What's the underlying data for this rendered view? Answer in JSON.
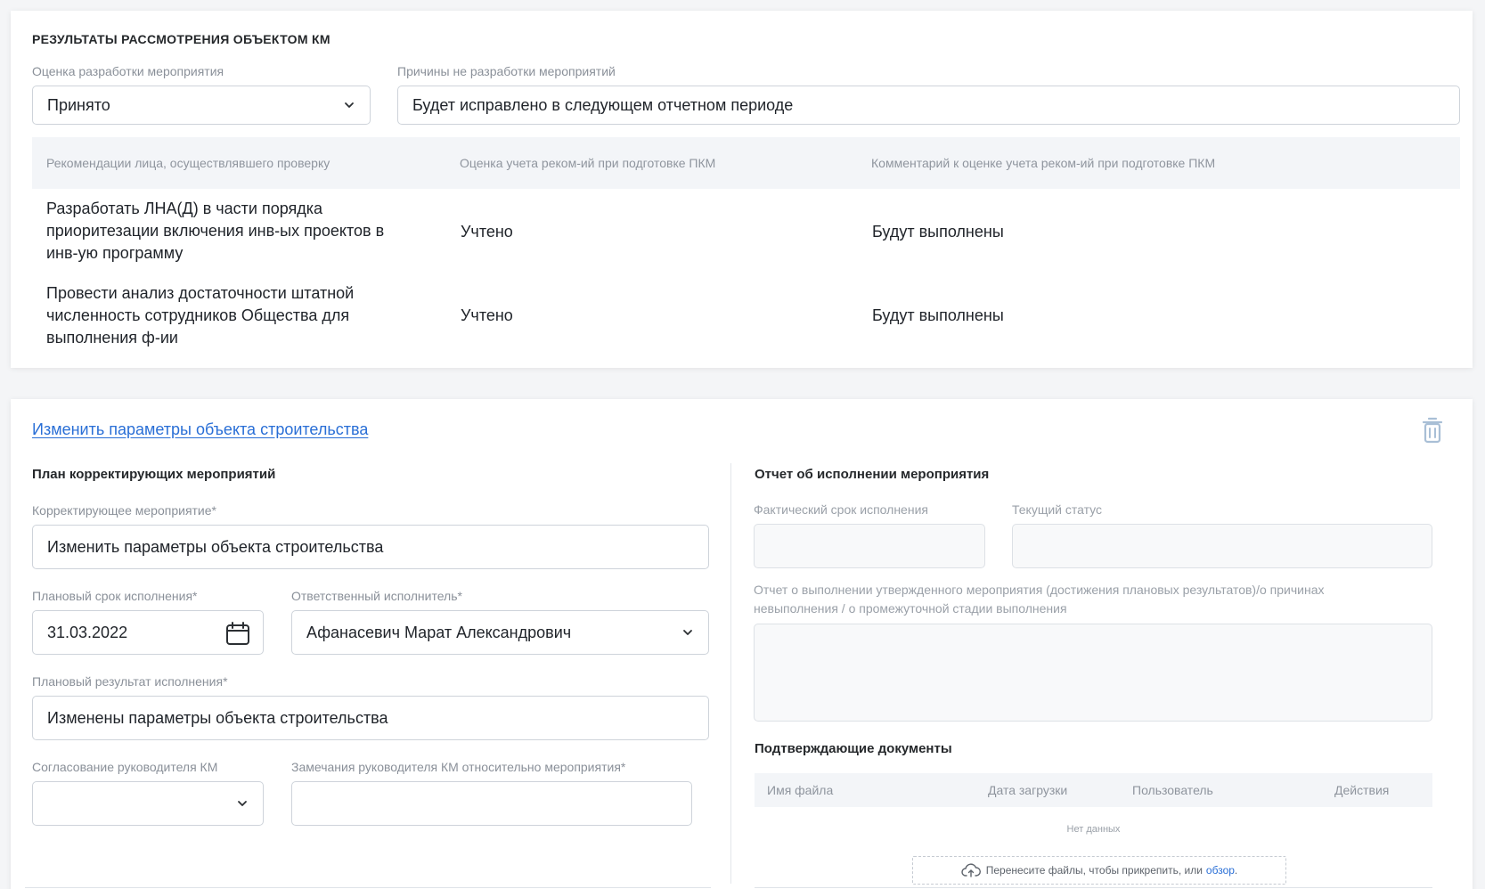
{
  "review": {
    "title": "РЕЗУЛЬТАТЫ РАССМОТРЕНИЯ ОБЪЕКТОМ КМ",
    "assessment_label": "Оценка разработки мероприятия",
    "assessment_value": "Принято",
    "reasons_label": "Причины не разработки мероприятий",
    "reasons_value": "Будет исправлено в следующем отчетном периоде",
    "table": {
      "headers": [
        "Рекомендации лица, осуществлявшего проверку",
        "Оценка учета реком-ий при подготовке ПКМ",
        "Комментарий к оценке учета реком-ий при подготовке ПКМ"
      ],
      "rows": [
        {
          "recommendation": "Разработать ЛНА(Д) в части порядка приоритезации включения инв-ых проектов в инв-ую программу",
          "assessment": "Учтено",
          "comment": "Будут выполнены"
        },
        {
          "recommendation": "Провести анализ достаточности штатной численность сотрудников Общества для выполнения ф-ии",
          "assessment": "Учтено",
          "comment": "Будут выполнены"
        }
      ]
    }
  },
  "plan": {
    "link": "Изменить параметры объекта строительства",
    "left_title": "План корректирующих мероприятий",
    "measure_label": "Корректирующее мероприятие*",
    "measure_value": "Изменить параметры объекта строительства",
    "due_label": "Плановый срок исполнения*",
    "due_value": "31.03.2022",
    "executor_label": "Ответственный исполнитель*",
    "executor_value": "Афанасевич Марат Александрович",
    "result_label": "Плановый результат исполнения*",
    "result_value": "Изменены параметры объекта строительства",
    "approval_label": "Согласование руководителя КМ",
    "approval_value": "",
    "remarks_label": "Замечания руководителя КМ относительно мероприятия*",
    "remarks_value": ""
  },
  "report": {
    "title": "Отчет об исполнении мероприятия",
    "actual_date_label": "Фактический срок исполнения",
    "status_label": "Текущий статус",
    "report_label_line1": "Отчет о выполнении утвержденного мероприятия (достижения плановых результатов)/о причинах",
    "report_label_line2": "невыполнения / о промежуточной стадии выполнения",
    "docs_title": "Подтверждающие документы",
    "docs_headers": [
      "Имя файла",
      "Дата загрузки",
      "Пользователь",
      "Действия"
    ],
    "no_data": "Нет данных",
    "drop_text": "Перенесите файлы, чтобы прикрепить, или",
    "browse": "обзор",
    "browse_suffix": "."
  },
  "colors": {
    "accent": "#2a6fd6",
    "border": "#ced3da",
    "table_header_bg": "#f3f5f8",
    "trash_icon": "#a9bfd6"
  },
  "icons": [
    "chevron-down-icon",
    "calendar-icon",
    "trash-icon",
    "cloud-upload-icon"
  ]
}
